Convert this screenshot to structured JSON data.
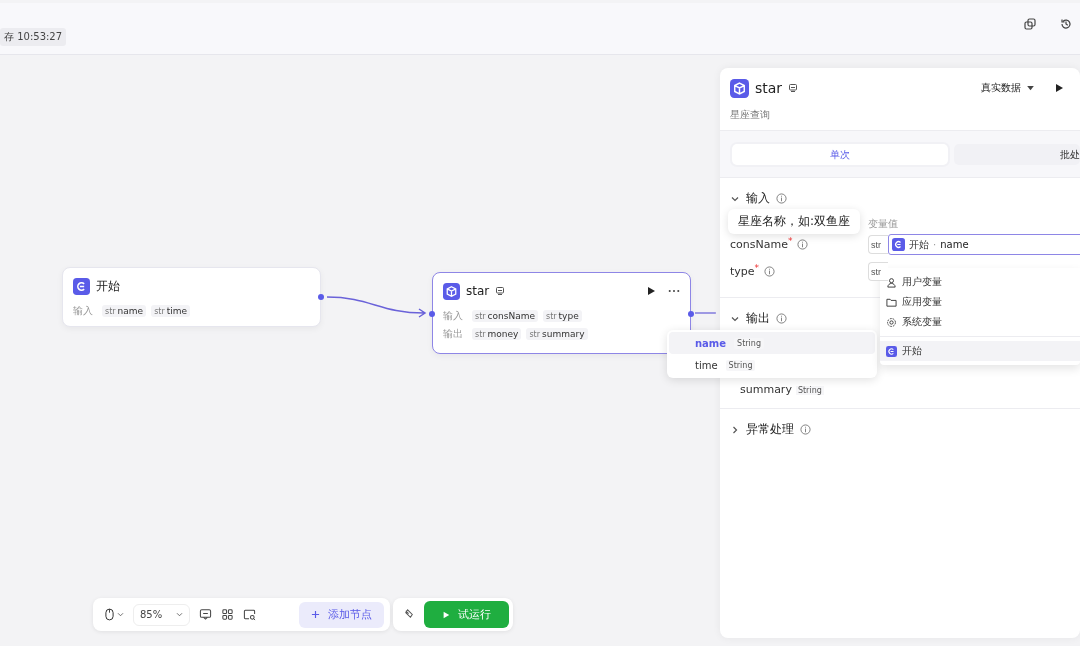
{
  "header": {
    "save_status": "存 10:53:27"
  },
  "nodes": [
    {
      "kind": "start",
      "title": "开始",
      "selected": false,
      "inputs_label": "输入",
      "inputs": [
        {
          "type": "str",
          "name": "name"
        },
        {
          "type": "str",
          "name": "time"
        }
      ]
    },
    {
      "kind": "plugin",
      "title": "star",
      "selected": true,
      "inputs_label": "输入",
      "inputs": [
        {
          "type": "str",
          "name": "consName"
        },
        {
          "type": "str",
          "name": "type"
        }
      ],
      "outputs_label": "输出",
      "outputs": [
        {
          "type": "str",
          "name": "money"
        },
        {
          "type": "str",
          "name": "summary"
        }
      ]
    }
  ],
  "panel": {
    "title": "star",
    "description": "星座查询",
    "data_mode": "真实数据",
    "tabs": [
      {
        "label": "单次",
        "selected": true
      },
      {
        "label": "批处",
        "selected": false
      }
    ],
    "input": {
      "title": "输入",
      "expanded": true,
      "value_header": "变量值",
      "required_mark": "*",
      "separator": "·",
      "params": [
        {
          "name": "consName",
          "required": true,
          "type": "str"
        },
        {
          "name": "type",
          "required": true,
          "type": "str"
        }
      ],
      "ref_node": "开始",
      "ref_var": "name"
    },
    "output": {
      "title": "输出",
      "expanded": true,
      "params": [
        {
          "name": "summary",
          "type": "String"
        }
      ]
    },
    "error": {
      "title": "异常处理",
      "expanded": false
    }
  },
  "tooltip": "星座名称，如:双鱼座",
  "var_menu": [
    {
      "kind": "user",
      "label": "用户变量",
      "selected": false
    },
    {
      "kind": "app",
      "label": "应用变量",
      "selected": false
    },
    {
      "kind": "system",
      "label": "系统变量",
      "selected": false
    },
    {
      "kind": "node",
      "label": "开始",
      "selected": true
    }
  ],
  "sub_menu": [
    {
      "name": "name",
      "type": "String",
      "selected": true
    },
    {
      "name": "time",
      "type": "String",
      "selected": false
    }
  ],
  "toolbar": {
    "zoom": "85%",
    "add_node": "添加节点",
    "run": "试运行"
  }
}
